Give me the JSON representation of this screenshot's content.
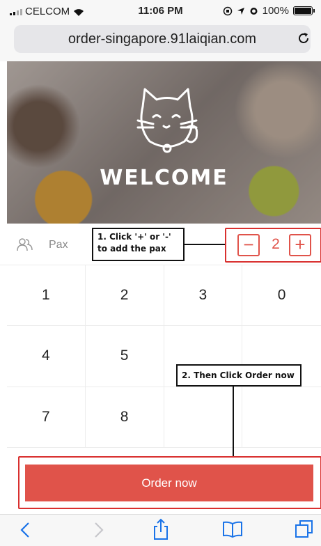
{
  "status_bar": {
    "carrier": "CELCOM",
    "time": "11:06 PM",
    "battery": "100%"
  },
  "browser": {
    "url": "order-singapore.91laiqian.com"
  },
  "hero": {
    "welcome_text": "WELCOME"
  },
  "pax": {
    "label": "Pax",
    "minus_label": "−",
    "value": "2",
    "plus_label": "+"
  },
  "keypad": {
    "keys": [
      "1",
      "2",
      "3",
      "0",
      "4",
      "5",
      "",
      "",
      "7",
      "8",
      "",
      ""
    ]
  },
  "annotations": {
    "step1_line1": "1. Click '+' or '-'",
    "step1_line2": "to add the pax",
    "step2": "2. Then Click Order now"
  },
  "order": {
    "button_label": "Order now"
  },
  "colors": {
    "accent": "#e0534a",
    "annotation_border": "#d9302f"
  }
}
